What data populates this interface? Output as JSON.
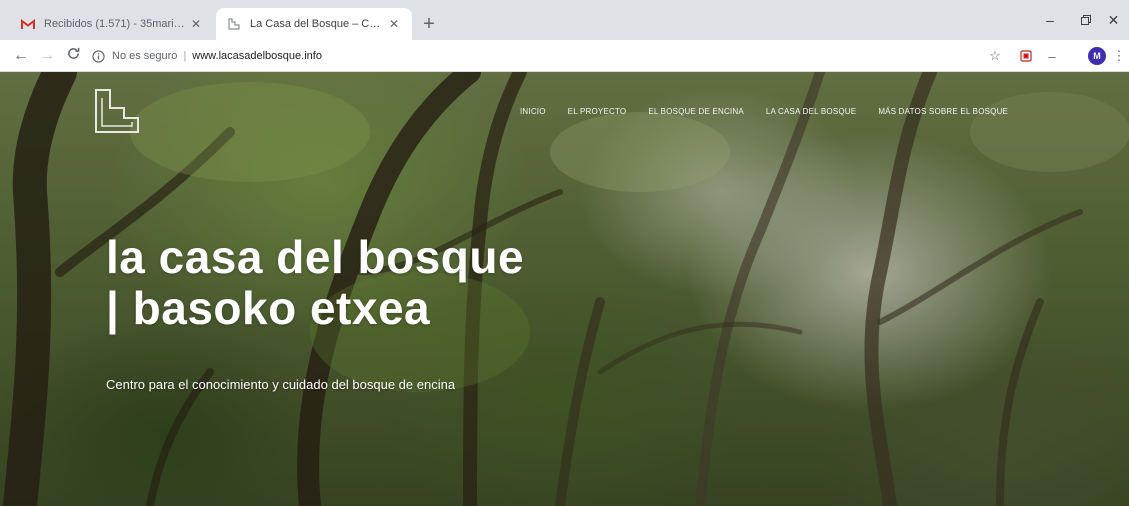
{
  "browser": {
    "tabs": [
      {
        "title": "Recibidos (1.571) - 35maribel@...",
        "favicon": "gmail-icon",
        "active": false
      },
      {
        "title": "La Casa del Bosque – Centro pa...",
        "favicon": "site-logo-icon",
        "active": true
      }
    ],
    "address": {
      "security_label": "No es seguro",
      "url": "www.lacasadelbosque.info"
    },
    "avatar_initial": "M"
  },
  "site": {
    "nav": [
      "INICIO",
      "EL PROYECTO",
      "EL BOSQUE DE ENCINA",
      "LA CASA DEL BOSQUE",
      "MÁS DATOS SOBRE EL BOSQUE"
    ],
    "headline_line1": "la casa del bosque",
    "headline_line2": "| basoko etxea",
    "tagline": "Centro para el conocimiento y cuidado del bosque de encina"
  },
  "colors": {
    "tabstrip": "#dee1e6",
    "gmail_red": "#d93025",
    "avatar": "#3b2fb0",
    "forest_green": "#586a38"
  }
}
